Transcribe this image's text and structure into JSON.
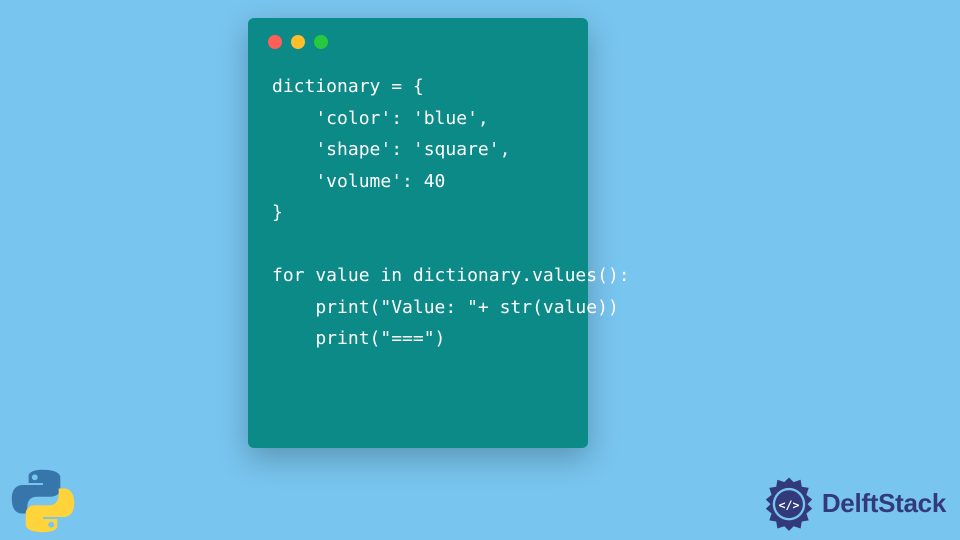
{
  "code": {
    "lines": [
      "dictionary = {",
      "    'color': 'blue',",
      "    'shape': 'square',",
      "    'volume': 40",
      "}",
      "",
      "for value in dictionary.values():",
      "    print(\"Value: \"+ str(value))",
      "    print(\"===\")"
    ]
  },
  "branding": {
    "site_name": "DelftStack"
  }
}
